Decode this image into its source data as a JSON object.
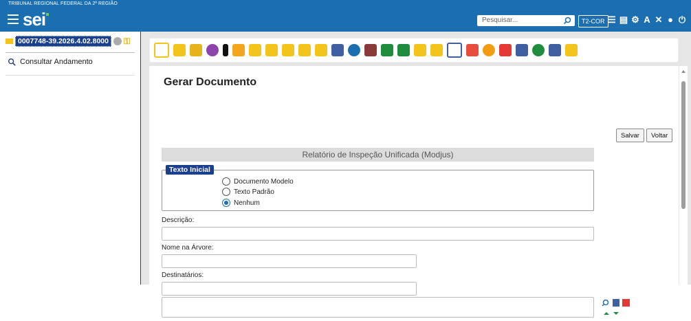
{
  "header": {
    "org_name": "TRIBUNAL REGIONAL FEDERAL DA 2ª REGIÃO",
    "logo_text": "sei",
    "search_placeholder": "Pesquisar...",
    "unit_label": "T2-COR",
    "icons": [
      "menu-icon",
      "search-icon",
      "list-icon",
      "calendar-icon",
      "gear-icon",
      "font-size-icon",
      "tools-icon",
      "user-icon",
      "power-icon"
    ]
  },
  "sidebar": {
    "process_number": "0007748-39.2026.4.02.8000",
    "items": [
      {
        "label": "Consultar Andamento",
        "icon": "search-icon"
      }
    ]
  },
  "toolbar": {
    "icons": [
      "new-document-icon",
      "update-folder-icon",
      "folder-settings-icon",
      "view-icon",
      "hand-icon",
      "thumbs-icon",
      "send-folder-icon",
      "info-folder-icon",
      "user-folder-icon",
      "star-folder-icon",
      "folder-icon",
      "email-icon",
      "sync-icon",
      "plus-folder-icon",
      "grid-icon",
      "map-icon",
      "paper-icon",
      "pause-folder-icon",
      "link-icon",
      "close-folder-icon",
      "comment-icon",
      "trash-icon",
      "tag-icon",
      "clock-icon",
      "list-icon",
      "search-folder-icon"
    ]
  },
  "form": {
    "title": "Gerar Documento",
    "save_label": "Salvar",
    "back_label": "Voltar",
    "doc_type": "Relatório de Inspeção Unificada (Modjus)",
    "initial_text_legend": "Texto Inicial",
    "radio_options": [
      "Documento Modelo",
      "Texto Padrão",
      "Nenhum"
    ],
    "selected_option": "Nenhum",
    "description_label": "Descrição:",
    "description_value": "",
    "tree_name_label": "Nome na Árvore:",
    "tree_name_value": "",
    "recipients_label": "Destinatários:",
    "recipients_value": ""
  },
  "colors": {
    "header_bg": "#1b6fb0",
    "process_badge": "#1b3f8f",
    "accent": "#f3c41b"
  }
}
